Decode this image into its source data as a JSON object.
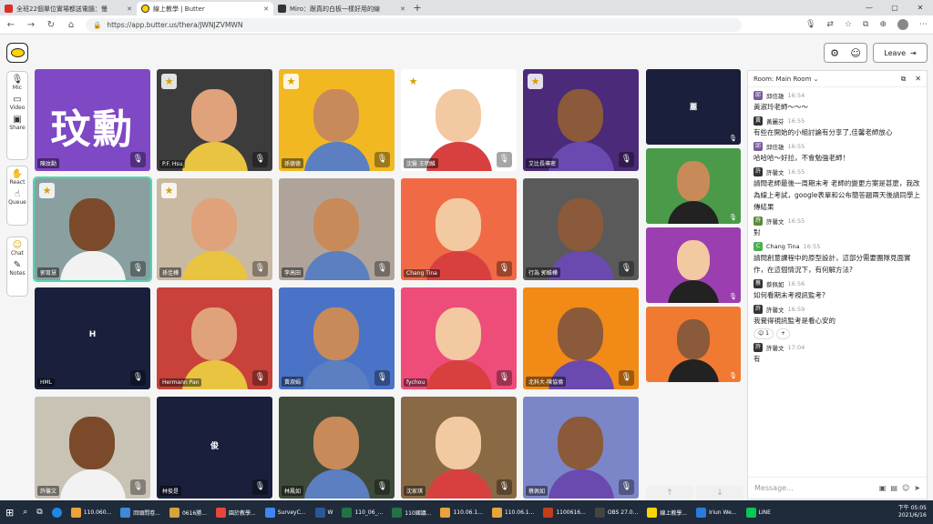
{
  "tabs": [
    {
      "title": "全班22個單位實場都送電腦：慢",
      "fav": "#d93025"
    },
    {
      "title": "線上教學 | Butter",
      "fav": "#ffd400"
    },
    {
      "title": "Miro：跟真的白板一樣好用的線",
      "fav": "#333"
    }
  ],
  "address": "https://app.butter.us/thera/JWNJZVMWN",
  "sidebar": {
    "mic": "Mic",
    "video": "Video",
    "share": "Share",
    "react": "React",
    "queue": "Queue",
    "chat": "Chat",
    "notes": "Notes"
  },
  "leave_label": "Leave",
  "tiles": [
    {
      "name": "陳玟勳",
      "big": "玟勳",
      "bg": "#7f48c4",
      "star": false
    },
    {
      "name": "P.F. Hsu",
      "bg": "#3c3c3c",
      "star": true
    },
    {
      "name": "孫德德",
      "bg": "#f2b822",
      "star": true
    },
    {
      "name": "沈醫 王明維",
      "bg": "#ffffff",
      "star": true
    },
    {
      "name": "艾比長導密",
      "bg": "#4b2a7a",
      "star": true
    },
    {
      "name": "郭育慧",
      "bg": "#8aa0a0",
      "star": true
    },
    {
      "name": "孫佳樺",
      "bg": "#c9b9a2",
      "star": true
    },
    {
      "name": "李高田",
      "bg": "#b0a49a",
      "star": false
    },
    {
      "name": "Chang Tina",
      "bg": "#f06b45",
      "star": false
    },
    {
      "name": "行為 郭維樺",
      "bg": "#5a5a5a",
      "star": false
    },
    {
      "name": "HML",
      "label": "H",
      "bg": "#1a1f3b",
      "star": false
    },
    {
      "name": "Hermann Pan",
      "bg": "#c8413a",
      "star": false
    },
    {
      "name": "黃淑娟",
      "bg": "#4a73c8",
      "star": false
    },
    {
      "name": "fychou",
      "bg": "#ee4d7a",
      "star": false
    },
    {
      "name": "北科大-陳協倫",
      "bg": "#f28a18",
      "star": false
    },
    {
      "name": "許馨文",
      "bg": "#c9c3b6",
      "star": false
    },
    {
      "name": "林俊是",
      "label": "俊",
      "bg": "#1a1f3b",
      "star": false
    },
    {
      "name": "林鳳如",
      "bg": "#3f4a3a",
      "star": false
    },
    {
      "name": "沈家琪",
      "bg": "#8a6a44",
      "star": false
    },
    {
      "name": "蔡佩如",
      "bg": "#7b86c8",
      "star": false
    }
  ],
  "side_tiles": [
    {
      "label": "麗",
      "bg": "#1a1f3b"
    },
    {
      "bg": "#4a9a4a"
    },
    {
      "bg": "#9b3fb0"
    },
    {
      "bg": "#f07a32"
    }
  ],
  "chat": {
    "room": "Room: Main Room",
    "placeholder": "Message...",
    "messages": [
      {
        "author": "邱信雄",
        "time": "16:54",
        "text": "黃淑玲老師～～～",
        "color": "#7a5c9c"
      },
      {
        "author": "黃麗芬",
        "time": "16:55",
        "text": "有些在開始的小組討論有分享了,佳馨老師放心",
        "color": "#333"
      },
      {
        "author": "邱信雄",
        "time": "16:55",
        "text": "哈哈哈～好拉，不會勉強老師！",
        "color": "#7a5c9c"
      },
      {
        "author": "許馨文",
        "time": "16:55",
        "text": "請問老師最後一周期末考 老師的變更方案是甚麼，我改為線上考試，google表單和公布簡答題兩天後請同學上傳結果",
        "color": "#333"
      },
      {
        "author": "許馨文",
        "time": "16:55",
        "text": "對",
        "color": "#5a8a3a"
      },
      {
        "author": "Chang Tina",
        "time": "16:55",
        "text": "請問創意課程中的原型設計，這部分需要團隊見面實作，在這個情況下，有何解方法?",
        "color": "#4caf50",
        "avletter": "C"
      },
      {
        "author": "蔡佩如",
        "time": "16:56",
        "text": "如何看期末考視訊監考?",
        "color": "#333"
      },
      {
        "author": "許馨文",
        "time": "16:59",
        "text": "我覺得視訊監考是看心安的",
        "color": "#333",
        "reaction": "1"
      },
      {
        "author": "許馨文",
        "time": "17:04",
        "text": "有",
        "color": "#333"
      }
    ]
  },
  "taskbar": [
    {
      "label": "110.060...",
      "c": "#e8a33d"
    },
    {
      "label": "回頭問卷...",
      "c": "#3c8ad8"
    },
    {
      "label": "0616勝...",
      "c": "#d8a23c"
    },
    {
      "label": "園於教學...",
      "c": "#e8453c"
    },
    {
      "label": "SurveyC...",
      "c": "#4285f4"
    },
    {
      "label": "W",
      "c": "#2b579a"
    },
    {
      "label": "110_06_...",
      "c": "#217346"
    },
    {
      "label": "110國議...",
      "c": "#217346"
    },
    {
      "label": "110.06.1...",
      "c": "#e8a33d"
    },
    {
      "label": "110.06.1...",
      "c": "#e8a33d"
    },
    {
      "label": "1100616...",
      "c": "#c43e1c"
    },
    {
      "label": "OBS 27.0...",
      "c": "#444"
    },
    {
      "label": "線上教學...",
      "c": "#ffd400"
    },
    {
      "label": "Iriun We...",
      "c": "#2b7bd8"
    },
    {
      "label": "LINE",
      "c": "#06c755"
    }
  ],
  "clock": {
    "time": "下午 05:05",
    "date": "2021/6/16"
  }
}
